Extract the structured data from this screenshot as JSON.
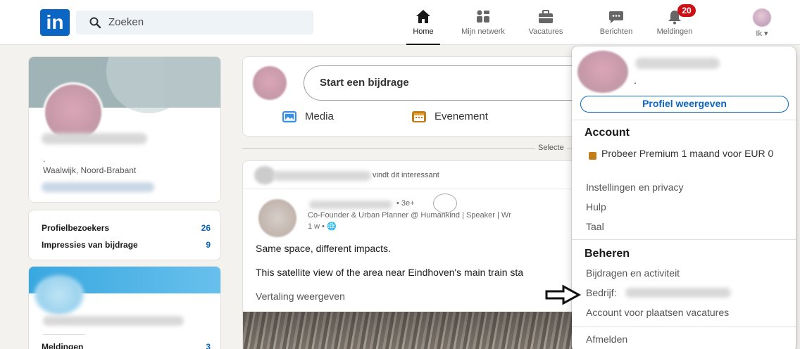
{
  "topbar": {
    "logo": "in",
    "search_placeholder": "Zoeken",
    "nav": {
      "home": "Home",
      "network": "Mijn netwerk",
      "jobs": "Vacatures",
      "messages": "Berichten",
      "notifications": "Meldingen",
      "notifications_badge": "20",
      "me": "Ik"
    }
  },
  "profile_card": {
    "dot": ".",
    "location": "Waalwijk, Noord-Brabant"
  },
  "stats": {
    "profile_visitors_label": "Profielbezoekers",
    "profile_visitors_value": "26",
    "impressions_label": "Impressies van bijdrage",
    "impressions_value": "9"
  },
  "card3": {
    "notifications_label": "Meldingen",
    "notifications_value": "3"
  },
  "share": {
    "placeholder": "Start een bijdrage",
    "media": "Media",
    "event": "Evenement"
  },
  "feed": {
    "select_label": "Selecte",
    "interest_text": "vindt dit interessant",
    "post_meta": "• 3e+",
    "post_subtitle": "Co-Founder & Urban Planner @ Humankind | Speaker | Wr",
    "post_time": "1 w •",
    "line1": "Same space, different impacts.",
    "line2": "This satellite view of the area near Eindhoven's main train sta",
    "line3": "Vertaling weergeven"
  },
  "dropdown": {
    "dot": ".",
    "view_profile": "Profiel weergeven",
    "account_heading": "Account",
    "premium": "Probeer Premium 1 maand voor EUR 0",
    "settings": "Instellingen en privacy",
    "help": "Hulp",
    "language": "Taal",
    "manage_heading": "Beheren",
    "posts_activity": "Bijdragen en activiteit",
    "company": "Bedrijf:",
    "job_account": "Account voor plaatsen vacatures",
    "sign_out": "Afmelden"
  },
  "colors": {
    "brand": "#0a66c2",
    "badge": "#cc1016",
    "background": "#f3f2ef"
  },
  "icons": [
    "search-icon",
    "home-icon",
    "network-icon",
    "briefcase-icon",
    "message-icon",
    "bell-icon",
    "image-icon",
    "calendar-icon",
    "globe-icon",
    "arrow-right-icon"
  ]
}
